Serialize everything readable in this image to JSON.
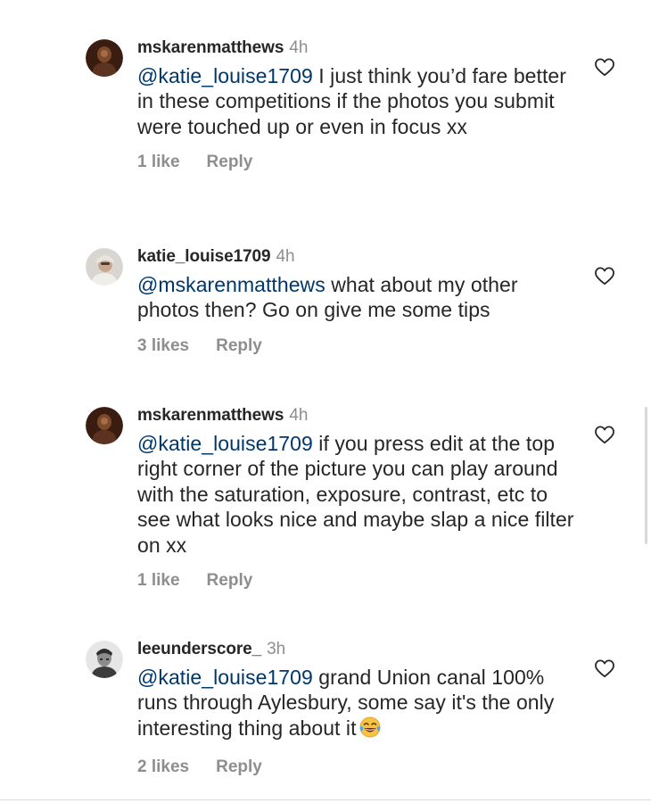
{
  "comments": [
    {
      "username": "mskarenmatthews",
      "time": "4h",
      "mention": "@katie_louise1709",
      "text": " I just think you’d fare better in these competitions if the photos you submit were touched up or even in focus xx",
      "likes": "1 like",
      "reply": "Reply",
      "avatar": "dark-brown-portrait-avatar"
    },
    {
      "username": "katie_louise1709",
      "time": "4h",
      "mention": "@mskarenmatthews",
      "text": " what about my other photos then? Go on give me some tips",
      "likes": "3 likes",
      "reply": "Reply",
      "avatar": "light-portrait-avatar"
    },
    {
      "username": "mskarenmatthews",
      "time": "4h",
      "mention": "@katie_louise1709",
      "text": " if you press edit at the top right corner of the picture you can play around with the saturation, exposure, contrast, etc to see what looks nice and maybe slap a nice filter on xx",
      "likes": "1 like",
      "reply": "Reply",
      "avatar": "dark-brown-portrait-avatar"
    },
    {
      "username": "leeunderscore_",
      "time": "3h",
      "mention": "@katie_louise1709",
      "text": " grand Union canal 100% runs through Aylesbury, some say it's the only interesting thing about it",
      "emoji": "tears-of-joy-emoji",
      "likes": "2 likes",
      "reply": "Reply",
      "avatar": "grayscale-portrait-avatar"
    }
  ],
  "colors": {
    "username": "#262626",
    "mention": "#00376b",
    "secondary": "#8e8e8e",
    "divider": "#dbdbdb"
  }
}
